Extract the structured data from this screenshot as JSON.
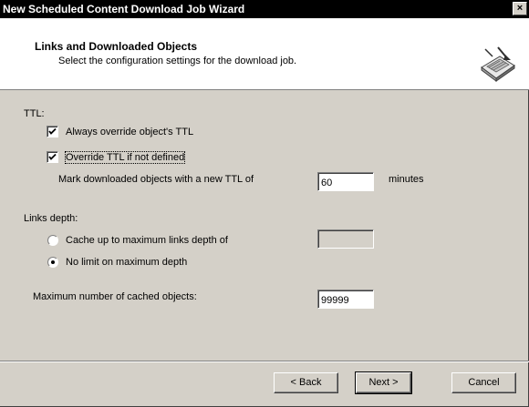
{
  "window": {
    "title": "New Scheduled Content Download Job Wizard",
    "close_glyph": "×"
  },
  "header": {
    "title": "Links and Downloaded Objects",
    "subtitle": "Select the configuration settings for the download job.",
    "icon": "wizard-download-icon"
  },
  "ttl": {
    "group_label": "TTL:",
    "always_override": {
      "label": "Always override object's TTL",
      "checked": true
    },
    "override_if_not_defined": {
      "label": "Override TTL if not defined",
      "checked": true
    },
    "mark_label": "Mark downloaded objects with a new TTL of",
    "ttl_value": "60",
    "units": "minutes"
  },
  "links": {
    "group_label": "Links depth:",
    "cache_up_to": {
      "label": "Cache up to maximum links depth of",
      "selected": false
    },
    "depth_value": "",
    "no_limit": {
      "label": "No limit on maximum depth",
      "selected": true
    }
  },
  "max_objects": {
    "label": "Maximum number of cached objects:",
    "value": "99999"
  },
  "buttons": {
    "back": "< Back",
    "next": "Next >",
    "cancel": "Cancel"
  }
}
